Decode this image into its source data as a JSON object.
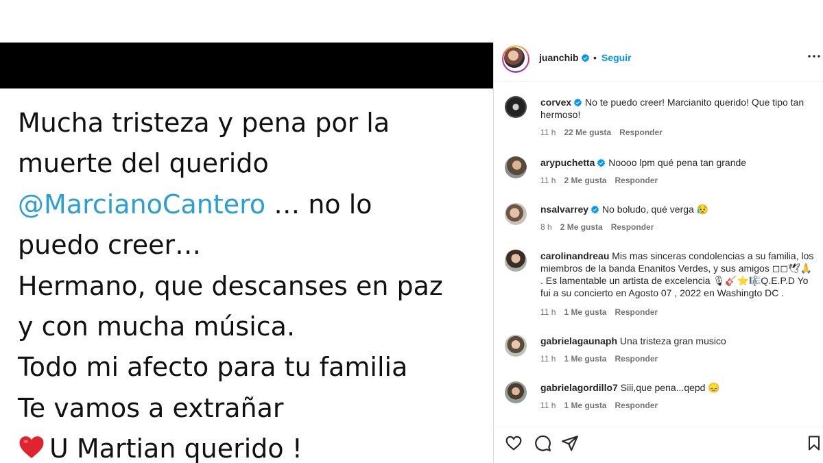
{
  "post": {
    "lines": [
      "Mucha tristeza y pena por la",
      "muerte del querido",
      "… no lo",
      "puedo creer…",
      "Hermano, que descanses en paz",
      "y con mucha música.",
      "Todo mi afecto para tu familia",
      "Te vamos a extrañar",
      "U Martian querido !"
    ],
    "mention": "@MarcianoCantero"
  },
  "header": {
    "username": "juanchib",
    "separator": "•",
    "follow_label": "Seguir"
  },
  "comments": [
    {
      "user": "corvex",
      "verified": true,
      "text": "No te puedo creer! Marcianito querido! Que tipo tan hermoso!",
      "time": "11 h",
      "likes": "22 Me gusta",
      "reply": "Responder"
    },
    {
      "user": "arypuchetta",
      "verified": true,
      "text": "Noooo lpm qué pena tan grande",
      "time": "11 h",
      "likes": "2 Me gusta",
      "reply": "Responder"
    },
    {
      "user": "nsalvarrey",
      "verified": true,
      "text": "No boludo, qué verga 😥",
      "time": "8 h",
      "likes": "2 Me gusta",
      "reply": "Responder"
    },
    {
      "user": "carolinandreau",
      "verified": false,
      "text": "Mis mas sinceras condolencias a su familia, los miembros de la banda Enanitos Verdes, y sus amigos ◻◻🕊🙏 . Es lamentable un artista de excelencia 🎙🎸⭐🎼Q.E.P.D Yo fui a su concierto en Agosto 07 , 2022 en Washingto DC .",
      "time": "11 h",
      "likes": "1 Me gusta",
      "reply": "Responder"
    },
    {
      "user": "gabrielagaunaph",
      "verified": false,
      "text": "Una tristeza gran musico",
      "time": "11 h",
      "likes": "1 Me gusta",
      "reply": "Responder"
    },
    {
      "user": "gabrielagordillo7",
      "verified": false,
      "text": "Siii,que pena...qepd 😞",
      "time": "11 h",
      "likes": "1 Me gusta",
      "reply": "Responder"
    }
  ],
  "icons": [
    "heart-icon",
    "comment-icon",
    "share-icon",
    "bookmark-icon",
    "more-options-icon",
    "verified-badge-icon"
  ],
  "colors": {
    "mention": "#2a9fd6",
    "follow": "#0095f6",
    "verified": "#0095f6",
    "meta": "#737373"
  }
}
